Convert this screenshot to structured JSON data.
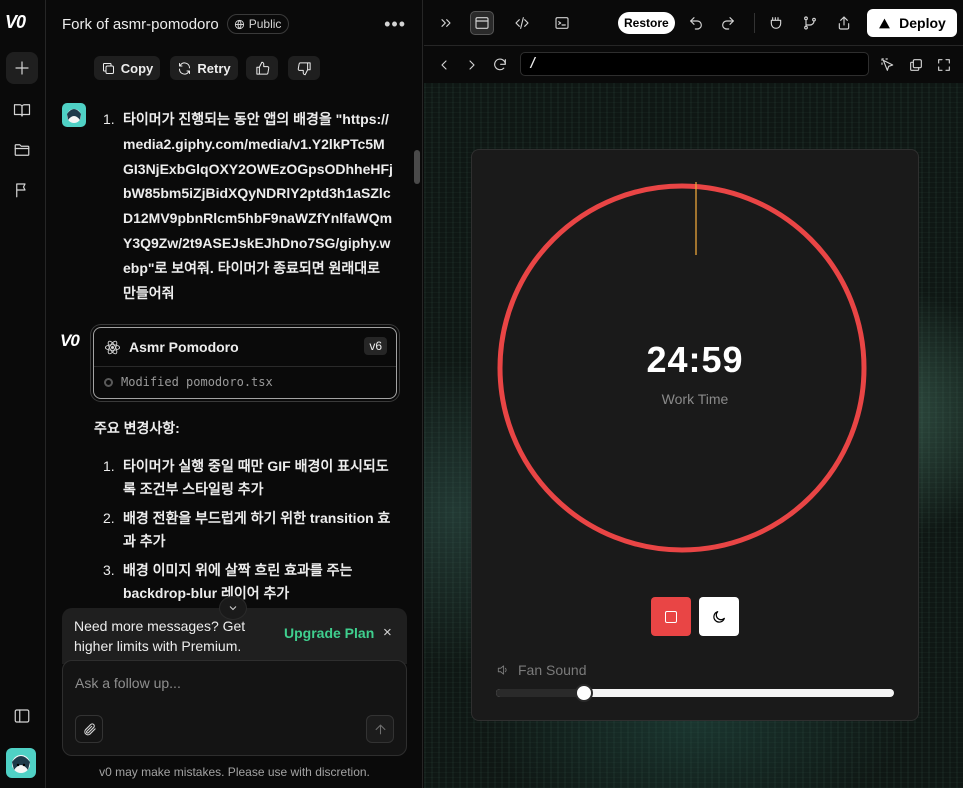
{
  "chat": {
    "project_title": "Fork of asmr-pomodoro",
    "visibility": "Public",
    "actions": {
      "copy": "Copy",
      "retry": "Retry"
    },
    "user_message": {
      "number": "1.",
      "text": "타이머가 진행되는 동안 앱의 배경을 \"https://media2.giphy.com/media/v1.Y2lkPTc5MGI3NjExbGlqOXY2OWEzOGpsODhheHFjbW85bm5iZjBidXQyNDRlY2ptd3h1aSZlcD12MV9pbnRlcm5hbF9naWZfYnlfaWQmY3Q9Zw/2t9ASEJskEJhDno7SG/giphy.webp\"로 보여줘. 타이머가 종료되면 원래대로 만들어줘"
    },
    "version_card": {
      "title": "Asmr Pomodoro",
      "version": "v6",
      "subtitle": "Modified pomodoro.tsx"
    },
    "changes_title": "주요 변경사항:",
    "changes": [
      {
        "num": "1.",
        "text": "타이머가 실행 중일 때만 GIF 배경이 표시되도록 조건부 스타일링 추가"
      },
      {
        "num": "2.",
        "text": "배경 전환을 부드럽게 하기 위한 transition 효과 추가"
      },
      {
        "num": "3.",
        "text": "배경 이미지 위에 살짝 흐린 효과를 주는 backdrop-blur 레이어 추가"
      }
    ],
    "upsell": {
      "text": "Need more messages? Get higher limits with Premium.",
      "link": "Upgrade Plan",
      "close": "×"
    },
    "composer": {
      "placeholder": "Ask a follow up..."
    },
    "disclaimer": "v0 may make mistakes. Please use with discretion.",
    "logo": "V0"
  },
  "toolbar": {
    "restore": "Restore",
    "deploy": "Deploy",
    "url": "/"
  },
  "timer": {
    "time": "24:59",
    "label": "Work Time",
    "ring_color": "#e94545",
    "progress_fraction": 0.0007,
    "sound_label": "Fan Sound",
    "volume_fraction": 0.22
  }
}
